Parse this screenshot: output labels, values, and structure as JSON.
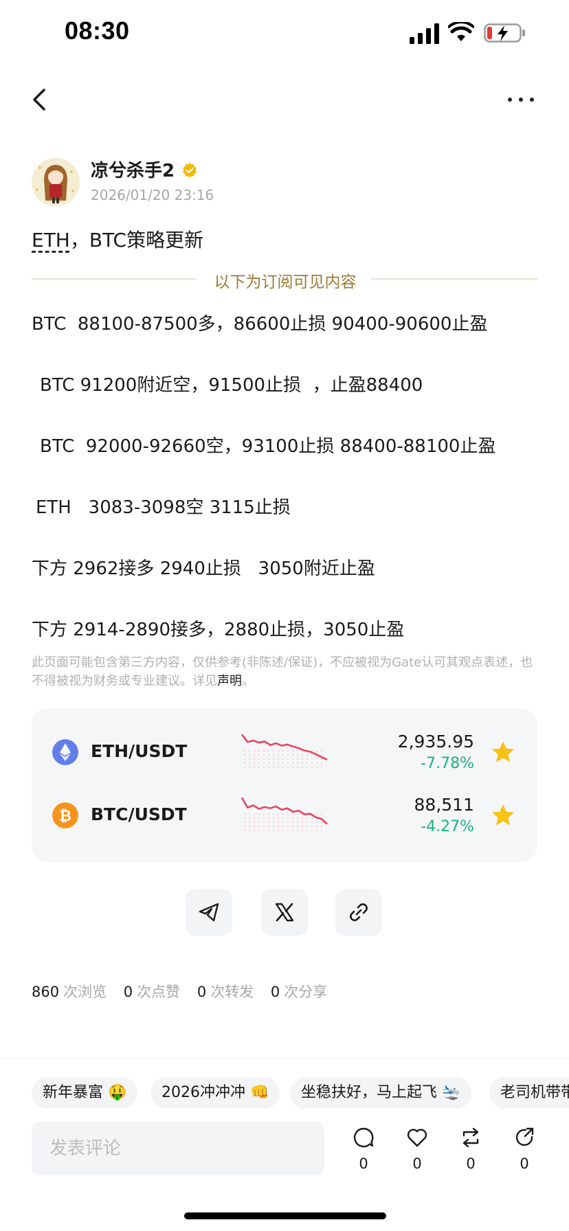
{
  "status_bar": {
    "time": "08:30"
  },
  "author": {
    "name": "凉兮杀手2",
    "time": "2026/01/20 23:16"
  },
  "post": {
    "title_tag": "ETH",
    "title_rest": "，BTC策略更新",
    "divider_label": "以下为订阅可见内容",
    "lines": [
      "BTC  88100-87500多，86600止损 90400-90600止盈",
      "BTC 91200附近空，91500止损  ，止盈88400",
      "BTC  92000-92660空，93100止损 88400-88100止盈",
      "ETH   3083-3098空 3115止损",
      "下方 2962接多 2940止损   3050附近止盈",
      "下方 2914-2890接多，2880止损，3050止盈"
    ],
    "disclaimer": "此页面可能包含第三方内容，仅供参考(非陈述/保证)，不应被视为Gate认可其观点表述，也不得被视为财务或专业建议。详见",
    "disclaimer_link": "声明",
    "disclaimer_end": "。"
  },
  "market": [
    {
      "pair": "ETH/USDT",
      "price": "2,935.95",
      "change": "-7.78%",
      "icon": "eth-icon",
      "color": "#627eea",
      "trend": [
        0.95,
        0.7,
        0.75,
        0.68,
        0.72,
        0.6,
        0.66,
        0.58,
        0.62,
        0.55,
        0.5,
        0.42,
        0.38,
        0.3,
        0.2,
        0.12
      ]
    },
    {
      "pair": "BTC/USDT",
      "price": "88,511",
      "change": "-4.27%",
      "icon": "btc-icon",
      "color": "#f7931a",
      "trend": [
        0.95,
        0.62,
        0.7,
        0.58,
        0.64,
        0.6,
        0.66,
        0.55,
        0.6,
        0.48,
        0.52,
        0.4,
        0.42,
        0.3,
        0.25,
        0.08
      ]
    }
  ],
  "colors": {
    "trend_line": "#e8455e",
    "up": "#19b37a",
    "star": "#f8c115",
    "accent_gold": "#9a7a35"
  },
  "stats": [
    {
      "num": "860",
      "label": "次浏览"
    },
    {
      "num": "0",
      "label": "次点赞"
    },
    {
      "num": "0",
      "label": "次转发"
    },
    {
      "num": "0",
      "label": "次分享"
    }
  ],
  "chips": [
    "新年暴富 🤑",
    "2026冲冲冲 👊",
    "坐稳扶好，马上起飞 🛬",
    "老司机带带"
  ],
  "comment": {
    "placeholder": "发表评论"
  },
  "actions": [
    {
      "icon": "comment-icon",
      "count": "0"
    },
    {
      "icon": "like-icon",
      "count": "0"
    },
    {
      "icon": "repost-icon",
      "count": "0"
    },
    {
      "icon": "share-icon",
      "count": "0"
    }
  ]
}
